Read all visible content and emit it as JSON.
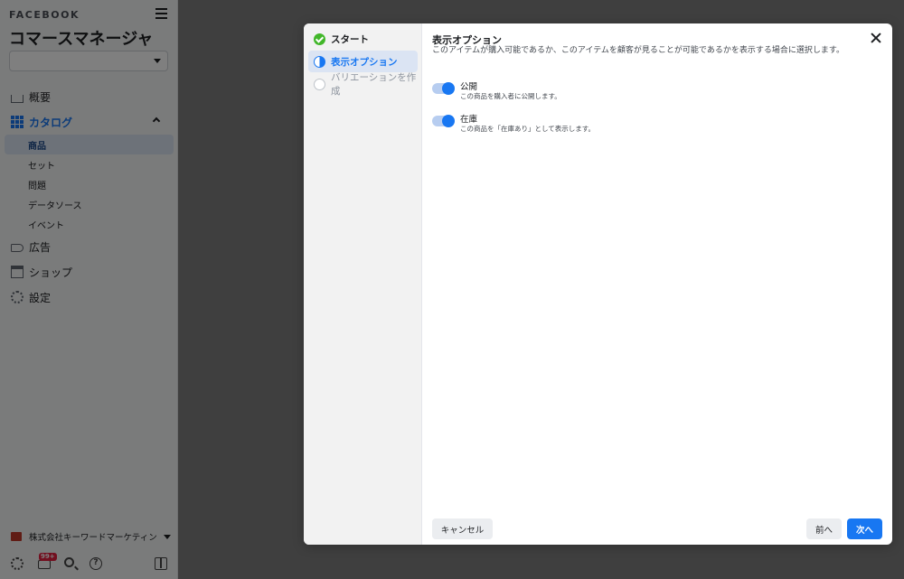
{
  "sidebar": {
    "brand": "FACEBOOK",
    "app_title": "コマースマネージャ",
    "account_select_value": "",
    "nav": {
      "overview": "概要",
      "catalog": "カタログ",
      "catalog_items": [
        "商品",
        "セット",
        "問題",
        "データソース",
        "イベント"
      ],
      "ads": "広告",
      "shop": "ショップ",
      "settings": "設定"
    },
    "business_name": "株式会社キーワードマーケティン",
    "notification_badge": "99+",
    "help_glyph": "?"
  },
  "modal": {
    "steps": [
      {
        "label": "スタート",
        "state": "done"
      },
      {
        "label": "表示オプション",
        "state": "current"
      },
      {
        "label": "バリエーションを作成",
        "state": "todo"
      }
    ],
    "title": "表示オプション",
    "description": "このアイテムが購入可能であるか、このアイテムを顧客が見ることが可能であるかを表示する場合に選択します。",
    "options": [
      {
        "label": "公開",
        "sub": "この商品を購入者に公開します。",
        "enabled": true
      },
      {
        "label": "在庫",
        "sub": "この商品を「在庫あり」として表示します。",
        "enabled": true
      }
    ],
    "buttons": {
      "cancel": "キャンセル",
      "prev": "前へ",
      "next": "次へ"
    }
  },
  "colors": {
    "accent": "#1877f2",
    "success": "#42b72a",
    "badge": "#e41e3f"
  }
}
